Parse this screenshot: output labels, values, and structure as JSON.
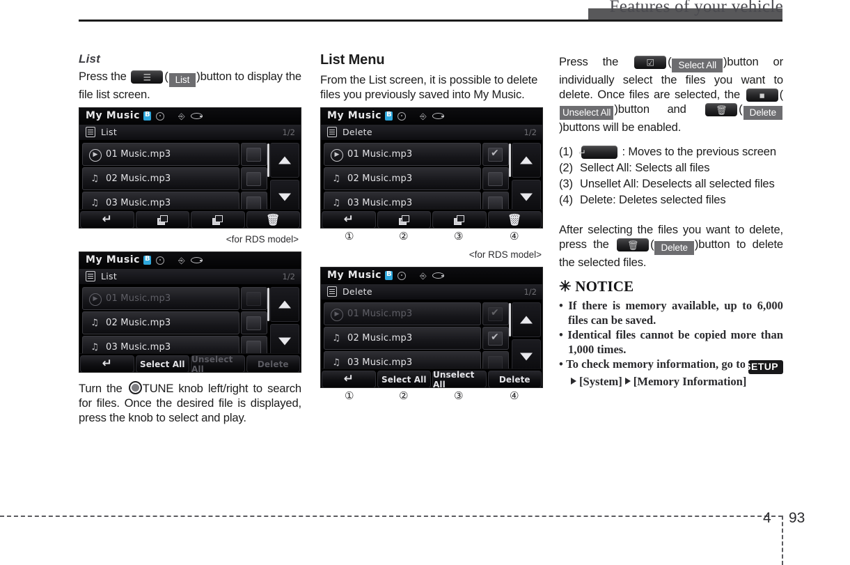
{
  "header": {
    "title": "Features of your vehicle"
  },
  "footer": {
    "chapter": "4",
    "page": "93"
  },
  "column_left": {
    "section_title": "List",
    "paragraph_1_pre": "Press the",
    "paragraph_1_mid": ")button to display the file list screen.",
    "chip_icon_name": "list-icon",
    "chip_label": "List",
    "caption_rds": "<for RDS model>",
    "paragraph_2": "Turn the",
    "paragraph_2_rest": "TUNE knob left/right to search for files. Once the desired file is displayed, press the knob to select and play.",
    "screen_1": {
      "title": "My Music",
      "menu_label": "List",
      "page_indicator": "1/2",
      "rows": [
        {
          "icon": "play-circle-icon",
          "text": "01 Music.mp3",
          "checked": false,
          "dim": false
        },
        {
          "icon": "music-note-icon",
          "text": "02 Music.mp3",
          "checked": false,
          "dim": false
        },
        {
          "icon": "music-note-icon",
          "text": "03 Music.mp3",
          "checked": false,
          "dim": false
        }
      ],
      "toolbar": [
        {
          "type": "icon",
          "icon": "back-arrow-icon",
          "label": ""
        },
        {
          "type": "icon",
          "icon": "select-all-stack-icon",
          "label": ""
        },
        {
          "type": "icon",
          "icon": "unselect-all-stack-icon",
          "label": ""
        },
        {
          "type": "icon",
          "icon": "trash-icon",
          "label": ""
        }
      ]
    },
    "screen_2": {
      "title": "My Music",
      "menu_label": "List",
      "page_indicator": "1/2",
      "rows": [
        {
          "icon": "play-circle-icon",
          "text": "01 Music.mp3",
          "checked": false,
          "dim": true
        },
        {
          "icon": "music-note-icon",
          "text": "02 Music.mp3",
          "checked": false,
          "dim": false
        },
        {
          "icon": "music-note-icon",
          "text": "03 Music.mp3",
          "checked": false,
          "dim": false
        }
      ],
      "toolbar": [
        {
          "type": "icon",
          "icon": "back-arrow-icon",
          "label": ""
        },
        {
          "type": "text",
          "icon": "",
          "label": "Select All"
        },
        {
          "type": "text",
          "icon": "",
          "label": "Unselect All"
        },
        {
          "type": "text",
          "icon": "",
          "label": "Delete"
        }
      ]
    }
  },
  "column_mid": {
    "section_title": "List Menu",
    "paragraph_1": "From the List screen, it is possible to delete files you previously saved into My Music.",
    "caption_rds": "<for RDS model>",
    "circled_numbers": [
      "①",
      "②",
      "③",
      "④"
    ],
    "screen_1": {
      "title": "My Music",
      "menu_label": "Delete",
      "page_indicator": "1/2",
      "rows": [
        {
          "icon": "play-circle-icon",
          "text": "01 Music.mp3",
          "checked": true,
          "dim": false
        },
        {
          "icon": "music-note-icon",
          "text": "02 Music.mp3",
          "checked": false,
          "dim": false
        },
        {
          "icon": "music-note-icon",
          "text": "03 Music.mp3",
          "checked": false,
          "dim": false
        }
      ],
      "toolbar": [
        {
          "type": "icon",
          "icon": "back-arrow-icon",
          "label": ""
        },
        {
          "type": "icon",
          "icon": "select-all-stack-icon",
          "label": ""
        },
        {
          "type": "icon",
          "icon": "unselect-all-stack-icon",
          "label": ""
        },
        {
          "type": "icon",
          "icon": "trash-icon",
          "label": ""
        }
      ]
    },
    "screen_2": {
      "title": "My Music",
      "menu_label": "Delete",
      "page_indicator": "1/2",
      "rows": [
        {
          "icon": "play-circle-icon",
          "text": "01 Music.mp3",
          "checked": true,
          "dim": true
        },
        {
          "icon": "music-note-icon",
          "text": "02 Music.mp3",
          "checked": true,
          "dim": false
        },
        {
          "icon": "music-note-icon",
          "text": "03 Music.mp3",
          "checked": false,
          "dim": false
        }
      ],
      "toolbar": [
        {
          "type": "icon",
          "icon": "back-arrow-icon",
          "label": ""
        },
        {
          "type": "text",
          "icon": "",
          "label": "Select All"
        },
        {
          "type": "text",
          "icon": "",
          "label": "Unselect All"
        },
        {
          "type": "text",
          "icon": "",
          "label": "Delete"
        }
      ]
    }
  },
  "column_right": {
    "para1_a": "Press the",
    "para1_b": ")button or individually select the files you want to delete. Once files are selected, the",
    "para1_c": ")button and",
    "para1_d": ")buttons will be enabled.",
    "chip_select_all": "Select All",
    "chip_unselect_all": "Unselect All",
    "chip_delete": "Delete",
    "list_items": [
      {
        "num": "(1)",
        "text": ": Moves to the previous screen",
        "has_icon": true
      },
      {
        "num": "(2)",
        "text": "Sellect All: Selects all files",
        "has_icon": false
      },
      {
        "num": "(3)",
        "text": "Unsellet All: Deselects all selected files",
        "has_icon": false
      },
      {
        "num": "(4)",
        "text": "Delete: Deletes selected files",
        "has_icon": false
      }
    ],
    "para2_a": "After selecting the files you want to delete, press the",
    "para2_b": ")button to delete the selected files.",
    "notice_title": "✳ NOTICE",
    "notice_items": [
      "If there is memory available, up to 6,000 files can be saved.",
      "Identical files cannot be copied more than 1,000 times."
    ],
    "notice_last_a": "To check memory information, go to",
    "notice_setup": "SETUP",
    "notice_last_b": "[System]",
    "notice_last_c": "[Memory Information]"
  },
  "colors": {
    "chip_label_bg": "#6d6d70",
    "screen_bg": "#000000",
    "header_rule": "#1b1b1b",
    "header_bar": "#58585a",
    "bluetooth": "#2fa8dd"
  }
}
